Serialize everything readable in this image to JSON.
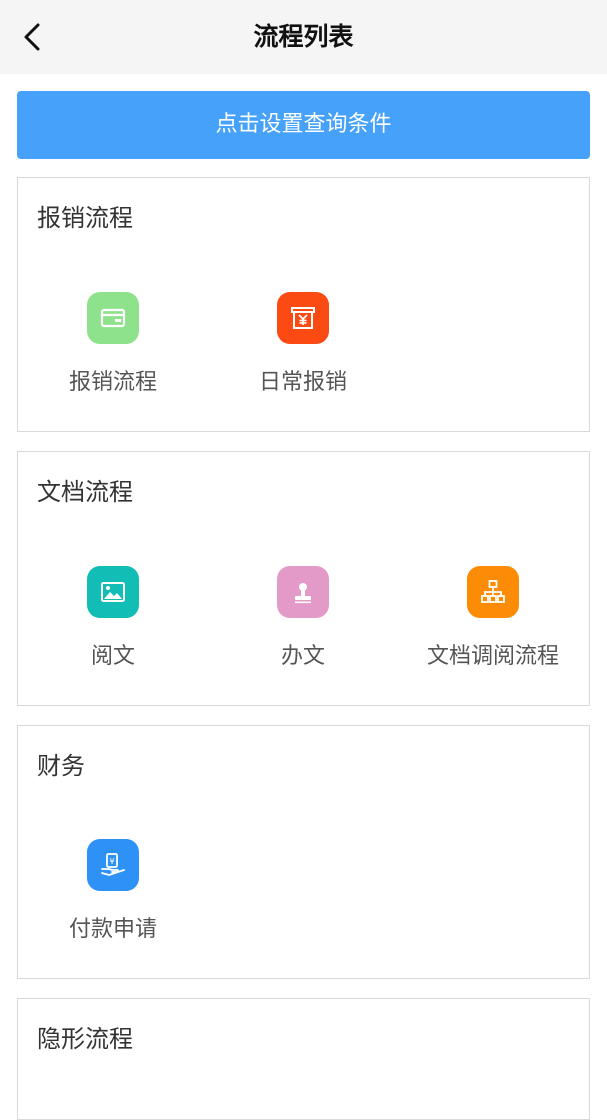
{
  "header": {
    "title": "流程列表",
    "back_icon": "chevron-left-icon"
  },
  "query_button": {
    "label": "点击设置查询条件",
    "color": "#45a1fa"
  },
  "sections": [
    {
      "title": "报销流程",
      "items": [
        {
          "label": "报销流程",
          "icon": "card-icon",
          "color": "#8ee28b"
        },
        {
          "label": "日常报销",
          "icon": "yen-receipt-icon",
          "color": "#fc4a13"
        }
      ]
    },
    {
      "title": "文档流程",
      "items": [
        {
          "label": "阅文",
          "icon": "image-icon",
          "color": "#12bdb6"
        },
        {
          "label": "办文",
          "icon": "stamp-icon",
          "color": "#e49ac9"
        },
        {
          "label": "文档调阅流程",
          "icon": "org-chart-icon",
          "color": "#fc8b06"
        }
      ]
    },
    {
      "title": "财务",
      "items": [
        {
          "label": "付款申请",
          "icon": "hand-payment-icon",
          "color": "#2e91f5"
        }
      ]
    },
    {
      "title": "隐形流程",
      "items": []
    }
  ]
}
